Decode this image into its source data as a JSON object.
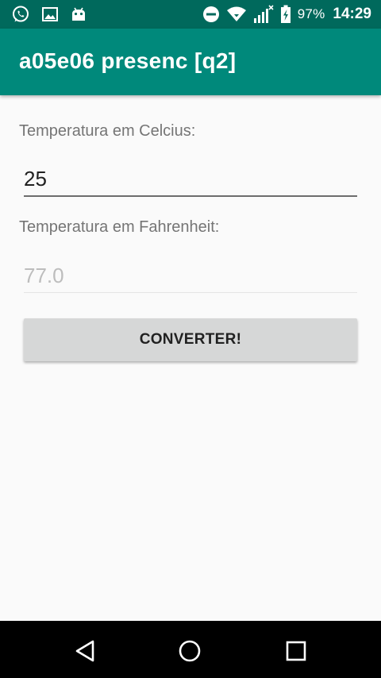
{
  "status_bar": {
    "left_icons": [
      "whatsapp-icon",
      "image-icon",
      "android-icon"
    ],
    "right_icons": [
      "do-not-disturb-icon",
      "wifi-icon",
      "cell-signal-icon",
      "battery-icon"
    ],
    "battery": "97%",
    "time": "14:29"
  },
  "app_bar": {
    "title": "a05e06 presenc [q2]",
    "color": "#00897b",
    "status_color": "#00695c"
  },
  "form": {
    "celsius_label": "Temperatura em Celcius:",
    "celsius_value": "25",
    "fahrenheit_label": "Temperatura em Fahrenheit:",
    "fahrenheit_value": "77.0",
    "convert_button": "CONVERTER!"
  },
  "nav_bar": {
    "icons": [
      "back-icon",
      "home-icon",
      "recent-apps-icon"
    ]
  }
}
